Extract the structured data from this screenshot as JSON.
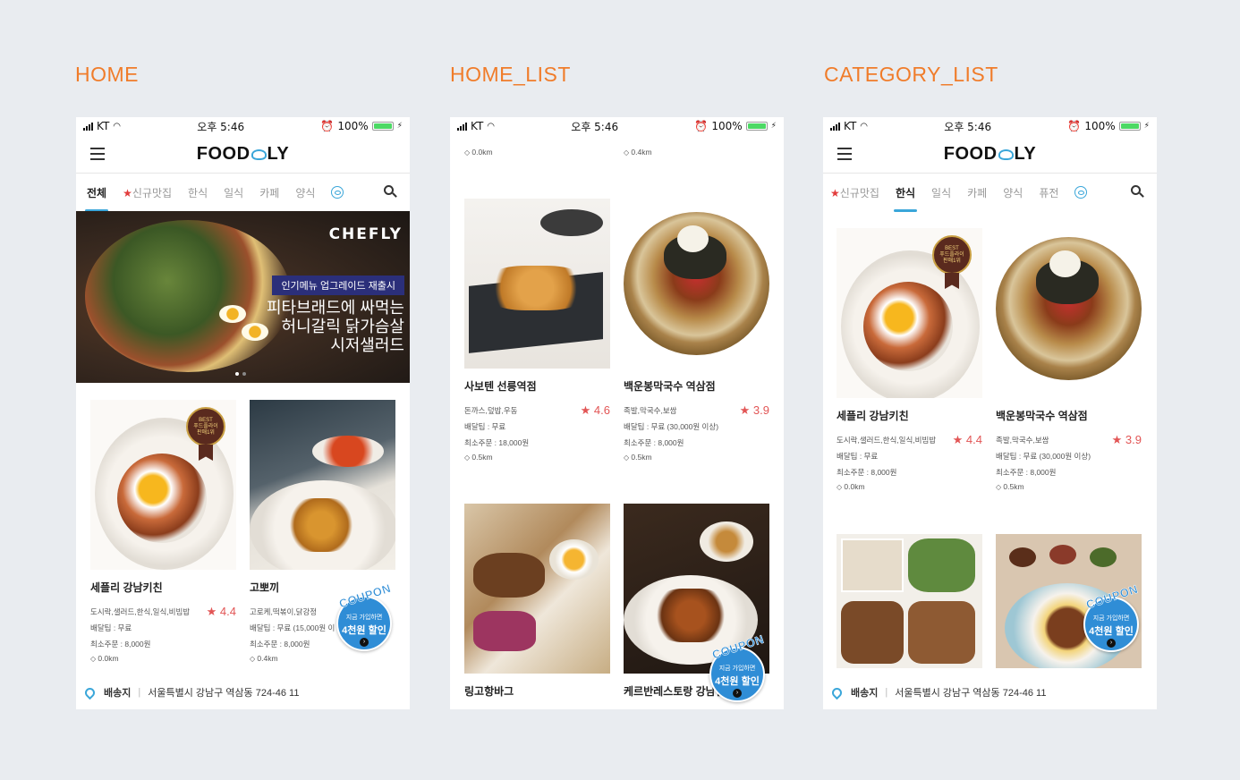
{
  "sections": {
    "home": "HOME",
    "home_list": "HOME_LIST",
    "category_list": "CATEGORY_LIST"
  },
  "status_bar": {
    "carrier": "KT",
    "time": "오후 5:46",
    "battery": "100%"
  },
  "app": {
    "logo_left": "FOOD",
    "logo_right": "LY"
  },
  "home": {
    "tabs": [
      "전체",
      "신규맛집",
      "한식",
      "일식",
      "카페",
      "양식"
    ],
    "banner": {
      "brand": "CHEFLY",
      "tag": "인기메뉴 업그레이드 재출시",
      "line1": "피타브래드에 싸먹는",
      "line2": "허니갈릭 닭가슴살",
      "line3": "시저샐러드"
    },
    "cards": [
      {
        "name": "세플리 강남키친",
        "category": "도시락,샐러드,한식,일식,비빔밥",
        "tip": "배달팁 : 무료",
        "min": "최소주문 : 8,000원",
        "dist": "0.0km",
        "rating": "★ 4.4"
      },
      {
        "name": "고뽀끼",
        "category": "고로케,떡볶이,닭강정",
        "tip": "배달팁 : 무료 (15,000원 이",
        "min": "최소주문 : 8,000원",
        "dist": "0.4km",
        "rating": ""
      }
    ]
  },
  "home_list": {
    "top_dist": [
      "0.0km",
      "0.4km"
    ],
    "cards": [
      {
        "name": "사보텐 선릉역점",
        "category": "돈까스,덮밥,우동",
        "tip": "배달팁 : 무료",
        "min": "최소주문 : 18,000원",
        "dist": "0.5km",
        "rating": "★ 4.6"
      },
      {
        "name": "백운봉막국수 역삼점",
        "category": "족발,막국수,보쌈",
        "tip": "배달팁 : 무료 (30,000원 이상)",
        "min": "최소주문 : 8,000원",
        "dist": "0.5km",
        "rating": "★ 3.9"
      }
    ],
    "bottom_names": [
      "링고항바그",
      "케르반레스토랑 강남점"
    ]
  },
  "category_list": {
    "tabs": [
      "신규맛집",
      "한식",
      "일식",
      "카페",
      "양식",
      "퓨전"
    ],
    "cards": [
      {
        "name": "세플리 강남키친",
        "category": "도시락,샐러드,한식,일식,비빔밥",
        "tip": "배달팁 : 무료",
        "min": "최소주문 : 8,000원",
        "dist": "0.0km",
        "rating": "★ 4.4"
      },
      {
        "name": "백운봉막국수 역삼점",
        "category": "족발,막국수,보쌈",
        "tip": "배달팁 : 무료 (30,000원 이상)",
        "min": "최소주문 : 8,000원",
        "dist": "0.5km",
        "rating": "★ 3.9"
      }
    ]
  },
  "ribbon": {
    "line1": "BEST",
    "line2": "푸드플라이",
    "line3": "판매1위"
  },
  "coupon": {
    "word": "COUPON",
    "line1": "지금 가입하면",
    "line2": "4천원 할인",
    "arrow": "›"
  },
  "footer": {
    "label": "배송지",
    "address": "서울특별시 강남구 역삼동 724-46 11"
  }
}
